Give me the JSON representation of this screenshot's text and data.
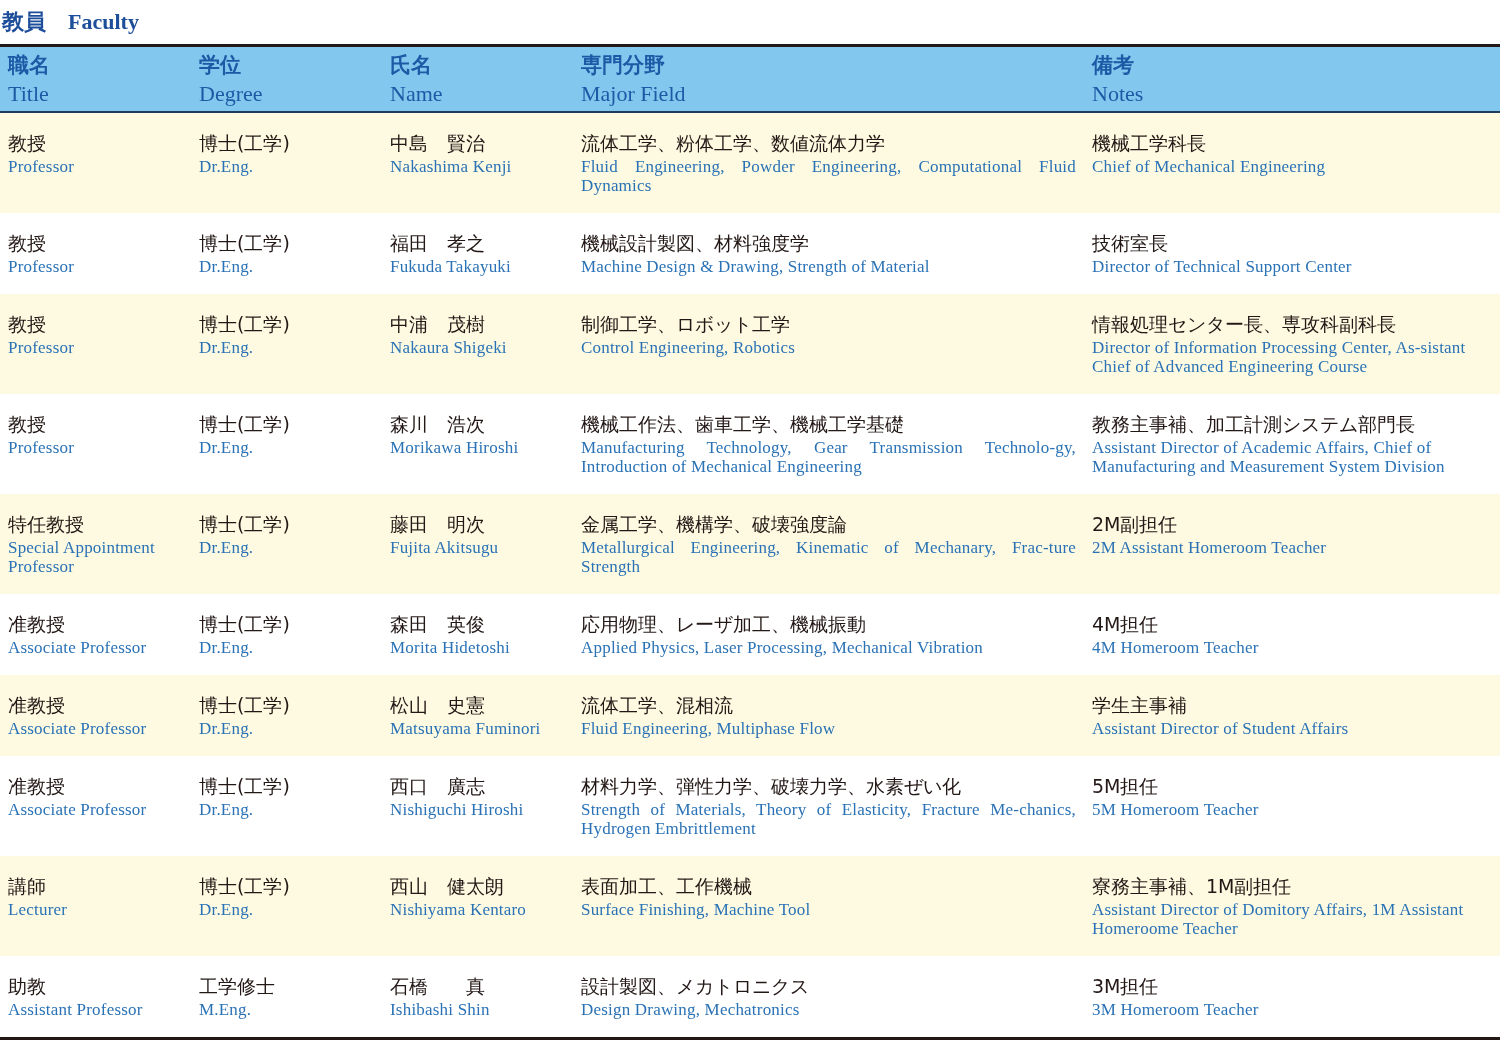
{
  "heading": {
    "ja": "教員",
    "en": "Faculty"
  },
  "columns": [
    {
      "ja": "職名",
      "en": "Title"
    },
    {
      "ja": "学位",
      "en": "Degree"
    },
    {
      "ja": "氏名",
      "en": "Name"
    },
    {
      "ja": "専門分野",
      "en": "Major Field"
    },
    {
      "ja": "備考",
      "en": "Notes"
    }
  ],
  "rows": [
    {
      "cells": [
        {
          "ja": "教授",
          "en": "Professor"
        },
        {
          "ja": "博士(工学)",
          "en": "Dr.Eng."
        },
        {
          "ja": "中島　賢治",
          "en": "Nakashima Kenji"
        },
        {
          "ja": "流体工学、粉体工学、数値流体力学",
          "en": "Fluid Engineering, Powder Engineering, Computational Fluid Dynamics"
        },
        {
          "ja": "機械工学科長",
          "en": "Chief of Mechanical Engineering"
        }
      ]
    },
    {
      "cells": [
        {
          "ja": "教授",
          "en": "Professor"
        },
        {
          "ja": "博士(工学)",
          "en": "Dr.Eng."
        },
        {
          "ja": "福田　孝之",
          "en": "Fukuda Takayuki"
        },
        {
          "ja": "機械設計製図、材料強度学",
          "en": "Machine Design & Drawing, Strength of Material"
        },
        {
          "ja": "技術室長",
          "en": "Director of Technical Support Center"
        }
      ]
    },
    {
      "cells": [
        {
          "ja": "教授",
          "en": "Professor"
        },
        {
          "ja": "博士(工学)",
          "en": "Dr.Eng."
        },
        {
          "ja": "中浦　茂樹",
          "en": "Nakaura Shigeki"
        },
        {
          "ja": "制御工学、ロボット工学",
          "en": "Control Engineering, Robotics"
        },
        {
          "ja": "情報処理センター長、専攻科副科長",
          "en": "Director of Information Processing Center, As-sistant Chief of Advanced Engineering Course"
        }
      ]
    },
    {
      "cells": [
        {
          "ja": "教授",
          "en": "Professor"
        },
        {
          "ja": "博士(工学)",
          "en": "Dr.Eng."
        },
        {
          "ja": "森川　浩次",
          "en": "Morikawa Hiroshi"
        },
        {
          "ja": "機械工作法、歯車工学、機械工学基礎",
          "en": "Manufacturing Technology, Gear Transmission Technolo-gy, Introduction of Mechanical Engineering"
        },
        {
          "ja": "教務主事補、加工計測システム部門長",
          "en": "Assistant Director of Academic Affairs, Chief of Manufacturing and Measurement System Division"
        }
      ]
    },
    {
      "cells": [
        {
          "ja": "特任教授",
          "en": "Special Appointment Professor"
        },
        {
          "ja": "博士(工学)",
          "en": "Dr.Eng."
        },
        {
          "ja": "藤田　明次",
          "en": "Fujita Akitsugu"
        },
        {
          "ja": "金属工学、機構学、破壊強度論",
          "en": "Metallurgical Engineering, Kinematic of Mechanary, Frac-ture Strength"
        },
        {
          "ja": "2M副担任",
          "en": "2M Assistant Homeroom Teacher"
        }
      ]
    },
    {
      "cells": [
        {
          "ja": "准教授",
          "en": "Associate Professor"
        },
        {
          "ja": "博士(工学)",
          "en": "Dr.Eng."
        },
        {
          "ja": "森田　英俊",
          "en": "Morita Hidetoshi"
        },
        {
          "ja": "応用物理、レーザ加工、機械振動",
          "en": "Applied Physics, Laser Processing, Mechanical Vibration"
        },
        {
          "ja": "4M担任",
          "en": "4M Homeroom Teacher"
        }
      ]
    },
    {
      "cells": [
        {
          "ja": "准教授",
          "en": "Associate Professor"
        },
        {
          "ja": "博士(工学)",
          "en": "Dr.Eng."
        },
        {
          "ja": "松山　史憲",
          "en": "Matsuyama Fuminori"
        },
        {
          "ja": "流体工学、混相流",
          "en": "Fluid Engineering, Multiphase Flow"
        },
        {
          "ja": "学生主事補",
          "en": "Assistant Director of Student Affairs"
        }
      ]
    },
    {
      "cells": [
        {
          "ja": "准教授",
          "en": "Associate Professor"
        },
        {
          "ja": "博士(工学)",
          "en": "Dr.Eng."
        },
        {
          "ja": "西口　廣志",
          "en": "Nishiguchi Hiroshi"
        },
        {
          "ja": "材料力学、弾性力学、破壊力学、水素ぜい化",
          "en": "Strength of Materials, Theory of Elasticity, Fracture Me-chanics, Hydrogen Embrittlement"
        },
        {
          "ja": "5M担任",
          "en": "5M Homeroom Teacher"
        }
      ]
    },
    {
      "cells": [
        {
          "ja": "講師",
          "en": "Lecturer"
        },
        {
          "ja": "博士(工学)",
          "en": "Dr.Eng."
        },
        {
          "ja": "西山　健太朗",
          "en": "Nishiyama Kentaro"
        },
        {
          "ja": "表面加工、工作機械",
          "en": "Surface Finishing, Machine Tool"
        },
        {
          "ja": "寮務主事補、1M副担任",
          "en": "Assistant Director of Domitory Affairs, 1M Assistant Homeroome Teacher"
        }
      ]
    },
    {
      "cells": [
        {
          "ja": "助教",
          "en": "Assistant Professor"
        },
        {
          "ja": "工学修士",
          "en": "M.Eng."
        },
        {
          "ja": "石橋　　真",
          "en": "Ishibashi Shin"
        },
        {
          "ja": "設計製図、メカトロニクス",
          "en": "Design Drawing, Mechatronics"
        },
        {
          "ja": "3M担任",
          "en": "3M Homeroom Teacher"
        }
      ]
    }
  ]
}
